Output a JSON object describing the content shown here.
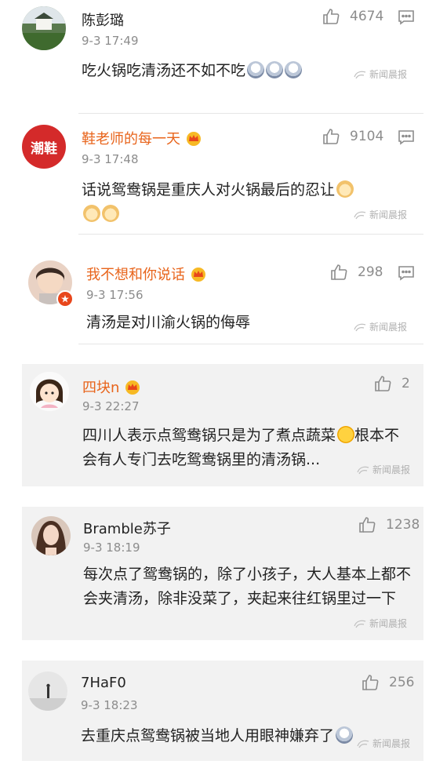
{
  "source_label": "新闻晨报",
  "comments": [
    {
      "name": "陈彭璐",
      "time": "9-3 17:49",
      "likes": "4674",
      "text": "吃火锅吃清汤还不如不吃"
    },
    {
      "name": "鞋老师的每一天",
      "time": "9-3 17:48",
      "likes": "9104",
      "text": "话说鸳鸯锅是重庆人对火锅最后的忍让",
      "avatar_text": "潮鞋"
    },
    {
      "name": "我不想和你说话",
      "time": "9-3 17:56",
      "likes": "298",
      "text": "清汤是对川渝火锅的侮辱"
    },
    {
      "name": "四块n",
      "time": "9-3 22:27",
      "likes": "2",
      "text": "四川人表示点鸳鸯锅只是为了煮点蔬菜",
      "text2": "根本不会有人专门去吃鸳鸯锅里的清汤锅..."
    },
    {
      "name": "Bramble苏子",
      "time": "9-3 18:19",
      "likes": "1238",
      "text": "每次点了鸳鸯锅的，除了小孩子，大人基本上都不会夹清汤，除非没菜了，夹起来往红锅里过一下"
    },
    {
      "name": "7HaF0",
      "time": "9-3 18:23",
      "likes": "256",
      "text": "去重庆点鸳鸯锅被当地人用眼神嫌弃了"
    }
  ],
  "colors": {
    "vip_name": "#e8641b",
    "meta": "#8c8c8c"
  }
}
